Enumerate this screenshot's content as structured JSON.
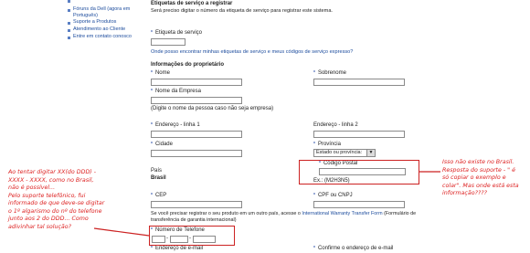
{
  "sidebar": {
    "items": [
      "Fóruns da Dell (agora em",
      "Português)",
      "Suporte a Produtos",
      "Atendimento ao Cliente",
      "Entre em contato conosco"
    ]
  },
  "form": {
    "section_title": "Etiquetas de serviço a registrar",
    "section_desc": "Será preciso digitar o número da etiqueta de serviço para registrar este sistema.",
    "service_tag_label": "Etiqueta de serviço",
    "find_link": "Onde posso encontrar minhas etiquetas de serviço e meus códigos de serviço expresso?",
    "owner_title": "Informações do proprietário",
    "first_name": "Nome",
    "last_name": "Sobrenome",
    "company": "Nome da Empresa",
    "company_hint": "(Digite o nome da pessoa caso não seja empresa)",
    "address1": "Endereço - linha 1",
    "address2": "Endereço - linha 2",
    "city": "Cidade",
    "province": "Província",
    "province_value": "Estado ou província:",
    "country_label": "País",
    "country_value": "Brasil",
    "postal_code": "Código Postal",
    "postal_example": "Ex.: (M2H3N5)",
    "cep": "CEP",
    "cpf": "CPF ou CNPJ",
    "transfer_text_1": "Se você precisar registrar o seu produto em um outro país, acesse o",
    "transfer_link": "International Warranty Transfer Form",
    "transfer_text_2": "(Formulário de",
    "transfer_text_3": "transferência de garantia internacional)",
    "phone": "Número de Telefone",
    "email": "Endereço de e-mail",
    "email_confirm": "Confirme o endereço de e-mail"
  },
  "annotations": {
    "left": [
      "Ao tentar digitar XX(do DDD) -",
      "XXXX - XXXX, como no Brasil,",
      "não é  possível...",
      "Pelo suporte telefônico, fui",
      "informado de que deve-se digitar",
      "o 1º algarismo do nº do telefone",
      "junto aos 2 do DDD... Como",
      "adivinhar tal solução?"
    ],
    "right": [
      "Isso não existe no Brasil.",
      "Resposta do suporte - \" é",
      "só copiar o exemplo e",
      "colar\". Mas onde está esta",
      "informação????"
    ]
  }
}
